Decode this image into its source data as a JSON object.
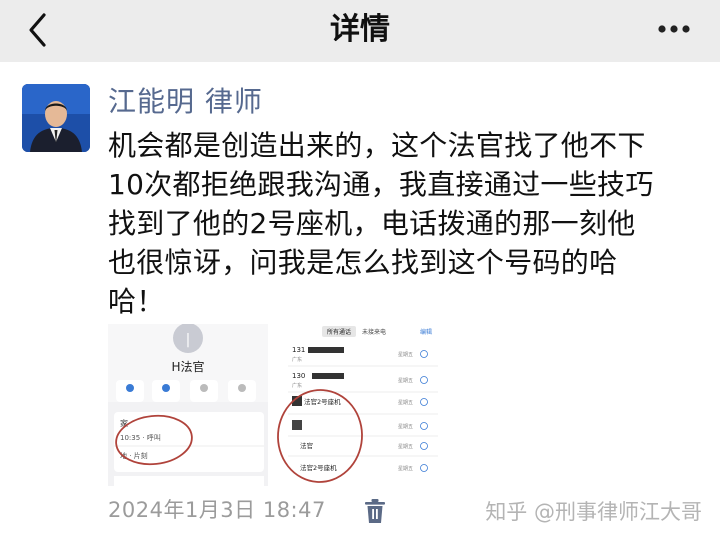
{
  "nav": {
    "title": "详情",
    "back_icon": "chevron-left-icon",
    "more_icon": "more-dots-icon"
  },
  "post": {
    "author": "江能明 律师",
    "lines": [
      "机会都是创造出来的，这个法官找了他不下",
      "10次都拒绝跟我沟通，我直接通过一些技巧",
      "找到了他的2号座机，电话拨通的那一刻他",
      "也很惊讶，问我是怎么找到这个号码的哈",
      "哈！"
    ],
    "timestamp": "2024年1月3日 18:47",
    "delete_icon": "trash-icon"
  },
  "image1": {
    "contact_name": "H法官",
    "row_top": "家",
    "row_sub": "10:35 · 呼叫",
    "row_bottom": "地 · 片刻"
  },
  "image2": {
    "tab_all": "所有通话",
    "tab_missed": "未接来电",
    "edit": "编辑",
    "entries": [
      {
        "name": "131",
        "sub": "广东",
        "time": "星期五"
      },
      {
        "name": "130",
        "sub": "广东",
        "time": "星期五"
      },
      {
        "name": "法官2号座机",
        "sub": "",
        "time": "星期五"
      },
      {
        "name": "",
        "sub": "",
        "time": "星期五"
      },
      {
        "name": "法官",
        "sub": "",
        "time": "星期五"
      },
      {
        "name": "法官2号座机",
        "sub": "",
        "time": "星期五"
      }
    ]
  },
  "watermark": "知乎 @刑事律师江大哥",
  "colors": {
    "nav_bg": "#ececec",
    "author": "#56698f",
    "meta": "#9b9b9b",
    "circle": "#b0433b"
  }
}
